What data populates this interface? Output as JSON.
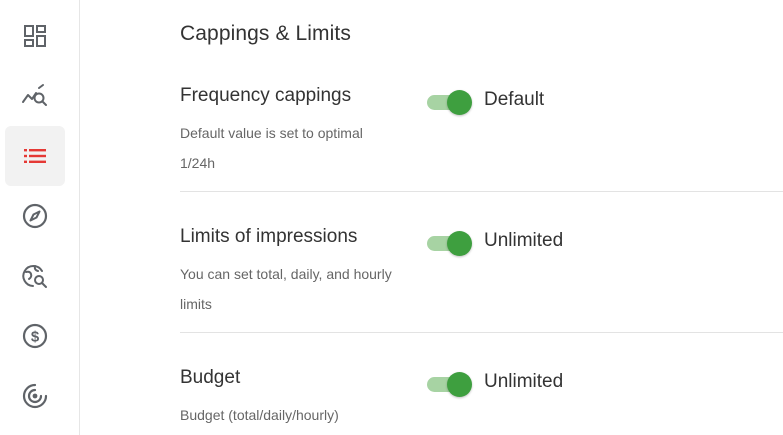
{
  "sidebar": {
    "items": [
      {
        "icon": "dashboard-icon",
        "active": false
      },
      {
        "icon": "analytics-search-icon",
        "active": false
      },
      {
        "icon": "list-icon",
        "active": true
      },
      {
        "icon": "compass-icon",
        "active": false
      },
      {
        "icon": "globe-search-icon",
        "active": false
      },
      {
        "icon": "dollar-icon",
        "active": false
      },
      {
        "icon": "target-icon",
        "active": false
      }
    ],
    "active_color": "#e53935",
    "icon_color": "#5f6368"
  },
  "section": {
    "title": "Cappings & Limits"
  },
  "rows": [
    {
      "title": "Frequency cappings",
      "description": "Default value is set to optimal 1/24h",
      "toggle_on": true,
      "toggle_label": "Default"
    },
    {
      "title": "Limits of impressions",
      "description": "You can set total, daily, and hourly limits",
      "toggle_on": true,
      "toggle_label": "Unlimited"
    },
    {
      "title": "Budget",
      "description": "Budget (total/daily/hourly)",
      "toggle_on": true,
      "toggle_label": "Unlimited"
    }
  ],
  "colors": {
    "toggle_track": "#a7d3a3",
    "toggle_knob": "#3e9f3f"
  }
}
